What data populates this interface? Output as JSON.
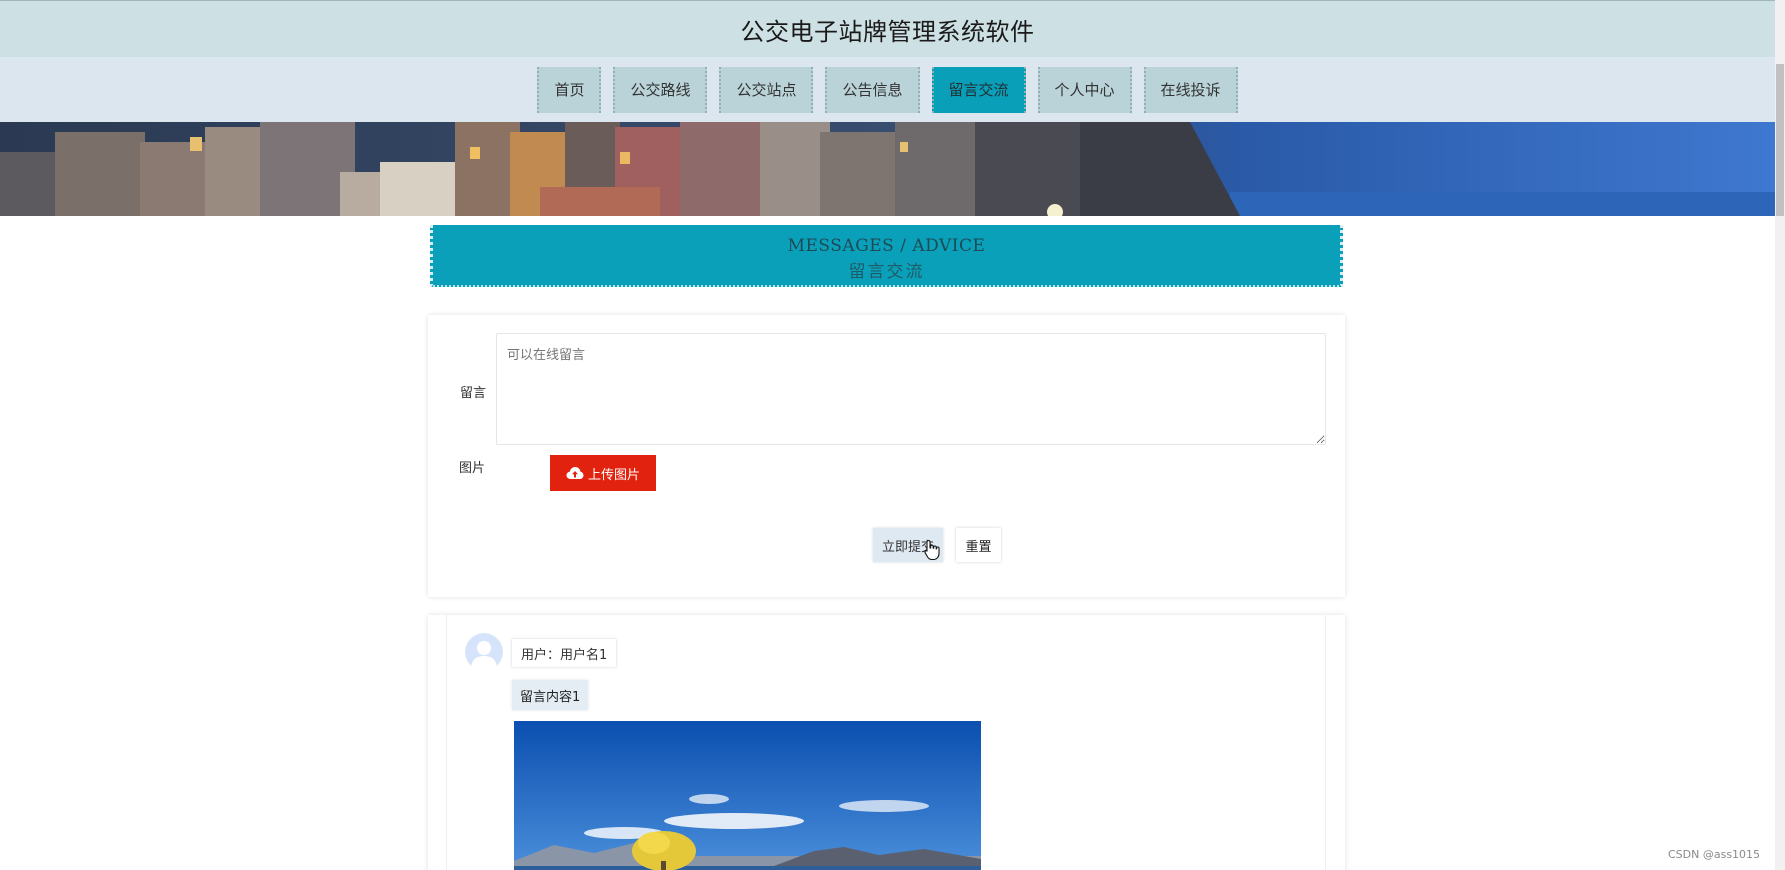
{
  "header": {
    "title": "公交电子站牌管理系统软件"
  },
  "nav": {
    "items": [
      {
        "label": "首页"
      },
      {
        "label": "公交路线"
      },
      {
        "label": "公交站点"
      },
      {
        "label": "公告信息"
      },
      {
        "label": "留言交流",
        "active": true
      },
      {
        "label": "个人中心"
      },
      {
        "label": "在线投诉"
      }
    ]
  },
  "section": {
    "title_en": "MESSAGES / ADVICE",
    "title_cn": "留言交流"
  },
  "form": {
    "message_label": "留言",
    "message_placeholder": "可以在线留言",
    "image_label": "图片",
    "upload_label": "上传图片",
    "upload_icon": "cloud-upload-icon",
    "submit_label": "立即提交",
    "reset_label": "重置"
  },
  "messages": [
    {
      "user": "用户：用户名1",
      "content": "留言内容1"
    }
  ],
  "colors": {
    "accent": "#0aa0ba",
    "upload": "#e0220f",
    "header_bg": "#cde0e4",
    "nav_bg": "#dbe6ee"
  },
  "watermark": "CSDN @ass1015"
}
